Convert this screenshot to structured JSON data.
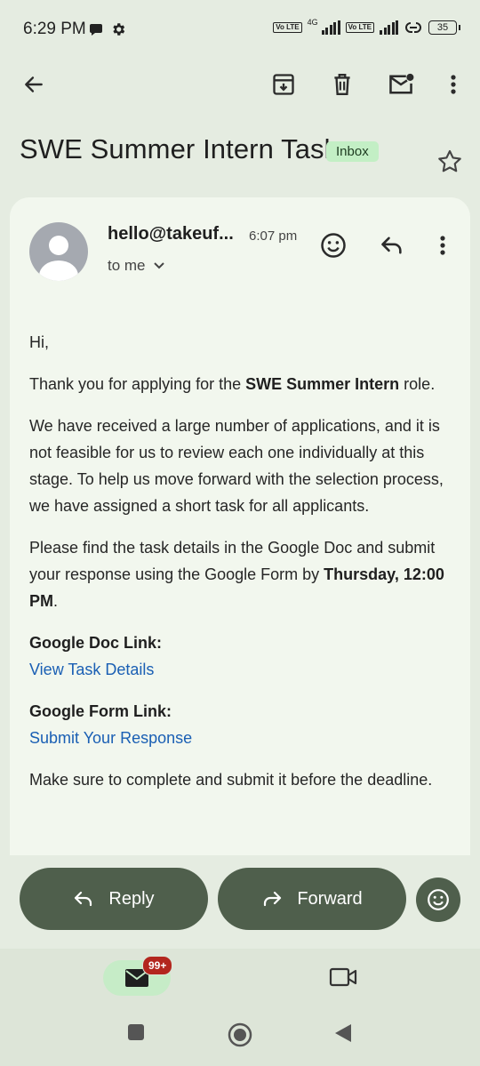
{
  "status": {
    "time": "6:29 PM",
    "net_label": "4G",
    "volte_label": "Vo LTE",
    "battery": "35"
  },
  "subject": "SWE Summer Intern Task",
  "label": "Inbox",
  "message": {
    "sender": "hello@takeuf...",
    "time": "6:07 pm",
    "to": "to me",
    "greeting": "Hi,",
    "p1_pre": "Thank you for applying for the ",
    "p1_bold": "SWE Summer Intern",
    "p1_post": " role.",
    "p2": "We have received a large number of applications, and it is not feasible for us to review each one individually at this stage. To help us move forward with the selection process, we have assigned a short task for all applicants.",
    "p3_pre": "Please find the task details in the Google Doc and submit your response using the Google Form by ",
    "p3_bold": "Thursday, 12:00 PM",
    "p3_post": ".",
    "doc_heading": "Google Doc Link:",
    "doc_link": "View Task Details",
    "form_heading": "Google Form Link:",
    "form_link": "Submit Your Response",
    "p4": "Make sure to complete and submit it before the deadline."
  },
  "actions": {
    "reply": "Reply",
    "forward": "Forward"
  },
  "nav": {
    "mail_badge": "99+"
  },
  "icons": {
    "back": "arrow-left-icon",
    "archive": "archive-icon",
    "delete": "trash-icon",
    "mark_unread": "mail-unread-icon",
    "more": "more-vert-icon",
    "star": "star-outline-icon",
    "emoji": "emoji-icon",
    "reply": "reply-icon",
    "forward": "forward-icon",
    "mail": "mail-icon",
    "video": "video-icon"
  },
  "colors": {
    "background": "#e5ece1",
    "card": "#f2f7ee",
    "pill": "#4f5f4c",
    "inbox_badge": "#c3efc5",
    "link": "#1a5fb4",
    "notification_badge": "#b3261e"
  }
}
